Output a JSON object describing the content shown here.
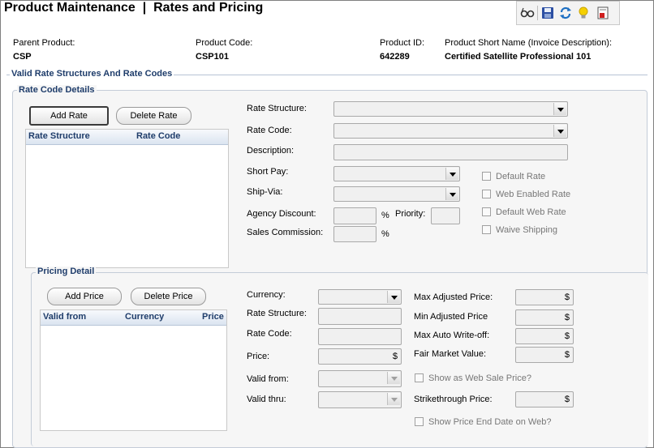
{
  "page": {
    "title": "Product Maintenance  |  Rates and Pricing"
  },
  "toolbar": {
    "icons": [
      "glasses-icon",
      "save-icon",
      "refresh-icon",
      "lightbulb-icon",
      "report-icon"
    ]
  },
  "product": {
    "parent_label": "Parent Product:",
    "parent_value": "CSP",
    "code_label": "Product Code:",
    "code_value": "CSP101",
    "id_label": "Product ID:",
    "id_value": "642289",
    "short_name_label": "Product Short Name (Invoice Description):",
    "short_name_value": "Certified Satellite Professional 101"
  },
  "rates": {
    "section_title": "Valid Rate Structures And Rate Codes",
    "group_title": "Rate Code Details",
    "add_label": "Add Rate",
    "delete_label": "Delete Rate",
    "grid_columns": [
      "Rate Structure",
      "Rate Code"
    ],
    "fields": {
      "rate_structure": "Rate Structure:",
      "rate_code": "Rate Code:",
      "description": "Description:",
      "short_pay": "Short Pay:",
      "ship_via": "Ship-Via:",
      "agency_discount": "Agency Discount:",
      "percent1": "%",
      "priority": "Priority:",
      "sales_commission": "Sales Commission:",
      "percent2": "%"
    },
    "checkboxes": {
      "default_rate": "Default Rate",
      "web_enabled": "Web Enabled Rate",
      "default_web": "Default Web Rate",
      "waive_shipping": "Waive Shipping"
    }
  },
  "pricing": {
    "group_title": "Pricing Detail",
    "add_label": "Add Price",
    "delete_label": "Delete Price",
    "grid_columns": [
      "Valid from",
      "Currency",
      "Price"
    ],
    "fields": {
      "currency": "Currency:",
      "rate_structure": "Rate Structure:",
      "rate_code": "Rate Code:",
      "price": "Price:",
      "valid_from": "Valid from:",
      "valid_thru": "Valid thru:",
      "max_adjusted": "Max Adjusted Price:",
      "min_adjusted": "Min Adjusted Price",
      "max_write_off": "Max Auto Write-off:",
      "fair_market": "Fair Market Value:",
      "strikethrough": "Strikethrough Price:"
    },
    "currency_symbol": "$",
    "checkboxes": {
      "web_sale": "Show as Web Sale Price?",
      "end_date": "Show Price End Date on Web?"
    }
  }
}
